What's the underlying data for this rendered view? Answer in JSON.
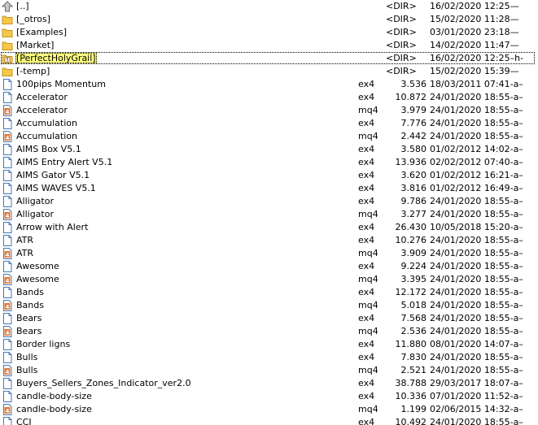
{
  "colors": {
    "folder": "#f5c84a",
    "folder_edge": "#c89418",
    "mq4_icon": "#e07b39",
    "page_icon": "#4a78b8"
  },
  "rows": [
    {
      "icon": "up-arrow-icon",
      "name": "[..]",
      "ext": "",
      "size": "<DIR>",
      "date": "16/02/2020 12:25—"
    },
    {
      "icon": "folder-icon",
      "name": "[_otros]",
      "ext": "",
      "size": "<DIR>",
      "date": "15/02/2020 11:28—"
    },
    {
      "icon": "folder-icon",
      "name": "[Examples]",
      "ext": "",
      "size": "<DIR>",
      "date": "03/01/2020 23:18—"
    },
    {
      "icon": "folder-icon",
      "name": "[Market]",
      "ext": "",
      "size": "<DIR>",
      "date": "14/02/2020 11:47—"
    },
    {
      "icon": "folder-alert-icon",
      "name": "[PerfectHolyGrail]",
      "ext": "",
      "size": "<DIR>",
      "date": "16/02/2020 12:25–h-",
      "selected": true
    },
    {
      "icon": "folder-icon",
      "name": "[-temp]",
      "ext": "",
      "size": "<DIR>",
      "date": "15/02/2020 15:39—"
    },
    {
      "icon": "file-icon",
      "name": "100pips Momentum",
      "ext": "ex4",
      "size": "3.536",
      "date": "18/03/2011 07:41-a–"
    },
    {
      "icon": "file-icon",
      "name": "Accelerator",
      "ext": "ex4",
      "size": "10.872",
      "date": "24/01/2020 18:55-a–"
    },
    {
      "icon": "mq4-file-icon",
      "name": "Accelerator",
      "ext": "mq4",
      "size": "3.979",
      "date": "24/01/2020 18:55-a–"
    },
    {
      "icon": "file-icon",
      "name": "Accumulation",
      "ext": "ex4",
      "size": "7.776",
      "date": "24/01/2020 18:55-a–"
    },
    {
      "icon": "mq4-file-icon",
      "name": "Accumulation",
      "ext": "mq4",
      "size": "2.442",
      "date": "24/01/2020 18:55-a–"
    },
    {
      "icon": "file-icon",
      "name": "AIMS Box V5.1",
      "ext": "ex4",
      "size": "3.580",
      "date": "01/02/2012 14:02-a–"
    },
    {
      "icon": "file-icon",
      "name": "AIMS Entry Alert V5.1",
      "ext": "ex4",
      "size": "13.936",
      "date": "02/02/2012 07:40-a–"
    },
    {
      "icon": "file-icon",
      "name": "AIMS Gator V5.1",
      "ext": "ex4",
      "size": "3.620",
      "date": "01/02/2012 16:21-a–"
    },
    {
      "icon": "file-icon",
      "name": "AIMS WAVES V5.1",
      "ext": "ex4",
      "size": "3.816",
      "date": "01/02/2012 16:49-a–"
    },
    {
      "icon": "file-icon",
      "name": "Alligator",
      "ext": "ex4",
      "size": "9.786",
      "date": "24/01/2020 18:55-a–"
    },
    {
      "icon": "mq4-file-icon",
      "name": "Alligator",
      "ext": "mq4",
      "size": "3.277",
      "date": "24/01/2020 18:55-a–"
    },
    {
      "icon": "file-icon",
      "name": "Arrow with Alert",
      "ext": "ex4",
      "size": "26.430",
      "date": "10/05/2018 15:20-a–"
    },
    {
      "icon": "file-icon",
      "name": "ATR",
      "ext": "ex4",
      "size": "10.276",
      "date": "24/01/2020 18:55-a–"
    },
    {
      "icon": "mq4-file-icon",
      "name": "ATR",
      "ext": "mq4",
      "size": "3.909",
      "date": "24/01/2020 18:55-a–"
    },
    {
      "icon": "file-icon",
      "name": "Awesome",
      "ext": "ex4",
      "size": "9.224",
      "date": "24/01/2020 18:55-a–"
    },
    {
      "icon": "mq4-file-icon",
      "name": "Awesome",
      "ext": "mq4",
      "size": "3.395",
      "date": "24/01/2020 18:55-a–"
    },
    {
      "icon": "file-icon",
      "name": "Bands",
      "ext": "ex4",
      "size": "12.172",
      "date": "24/01/2020 18:55-a–"
    },
    {
      "icon": "mq4-file-icon",
      "name": "Bands",
      "ext": "mq4",
      "size": "5.018",
      "date": "24/01/2020 18:55-a–"
    },
    {
      "icon": "file-icon",
      "name": "Bears",
      "ext": "ex4",
      "size": "7.568",
      "date": "24/01/2020 18:55-a–"
    },
    {
      "icon": "mq4-file-icon",
      "name": "Bears",
      "ext": "mq4",
      "size": "2.536",
      "date": "24/01/2020 18:55-a–"
    },
    {
      "icon": "file-icon",
      "name": "Border ligns",
      "ext": "ex4",
      "size": "11.880",
      "date": "08/01/2020 14:07-a–"
    },
    {
      "icon": "file-icon",
      "name": "Bulls",
      "ext": "ex4",
      "size": "7.830",
      "date": "24/01/2020 18:55-a–"
    },
    {
      "icon": "mq4-file-icon",
      "name": "Bulls",
      "ext": "mq4",
      "size": "2.521",
      "date": "24/01/2020 18:55-a–"
    },
    {
      "icon": "file-icon",
      "name": "Buyers_Sellers_Zones_Indicator_ver2.0",
      "ext": "ex4",
      "size": "38.788",
      "date": "29/03/2017 18:07-a–"
    },
    {
      "icon": "file-icon",
      "name": "candle-body-size",
      "ext": "ex4",
      "size": "10.336",
      "date": "07/01/2020 11:52-a–"
    },
    {
      "icon": "mq4-file-icon",
      "name": "candle-body-size",
      "ext": "mq4",
      "size": "1.199",
      "date": "02/06/2015 14:32-a–"
    },
    {
      "icon": "file-icon",
      "name": "CCI",
      "ext": "ex4",
      "size": "10.492",
      "date": "24/01/2020 18:55-a–"
    }
  ]
}
